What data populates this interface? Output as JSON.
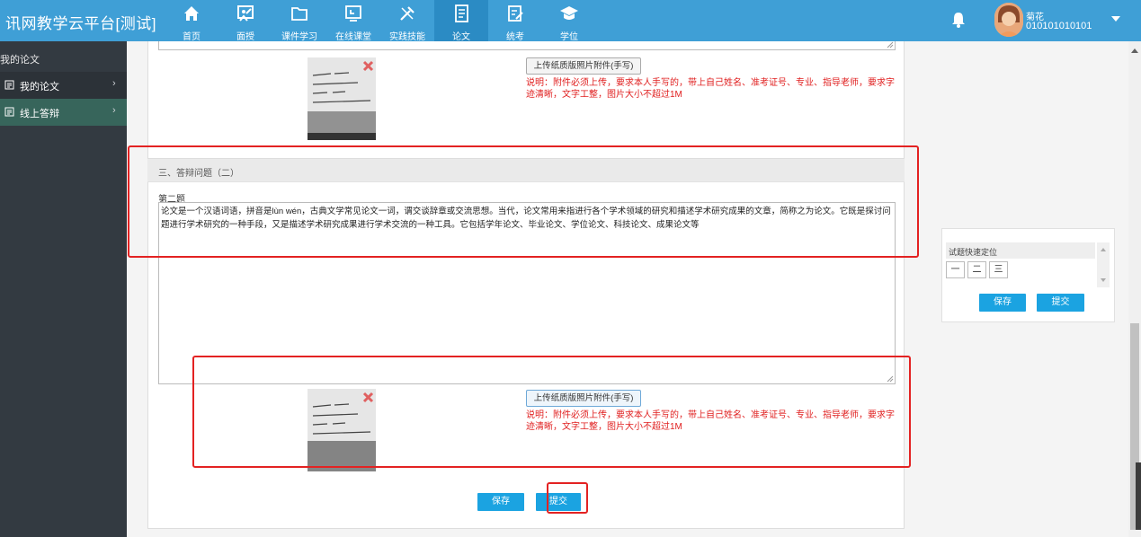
{
  "app": {
    "title": "讯网教学云平台[测试]"
  },
  "nav": {
    "items": [
      {
        "label": "首页",
        "icon": "home-icon"
      },
      {
        "label": "面授",
        "icon": "classroom-icon"
      },
      {
        "label": "课件学习",
        "icon": "folder-icon"
      },
      {
        "label": "在线课堂",
        "icon": "online-class-icon"
      },
      {
        "label": "实践技能",
        "icon": "tools-icon"
      },
      {
        "label": "论文",
        "icon": "paper-icon",
        "active": true
      },
      {
        "label": "统考",
        "icon": "exam-icon"
      },
      {
        "label": "学位",
        "icon": "graduation-cap-icon"
      }
    ]
  },
  "user": {
    "name": "菊花",
    "id": "010101010101"
  },
  "sidebar": {
    "title": "我的论文",
    "items": [
      {
        "label": "我的论文"
      },
      {
        "label": "线上答辩"
      }
    ]
  },
  "section": {
    "title": "三、答辩问题（二）",
    "question_label": "第二题",
    "answer": "论文是一个汉语词语，拼音是lùn wén，古典文学常见论文一词，谓交谈辞章或交流思想。当代，论文常用来指进行各个学术领域的研究和描述学术研究成果的文章，简称之为论文。它既是探讨问题进行学术研究的一种手段，又是描述学术研究成果进行学术交流的一种工具。它包括学年论文、毕业论文、学位论文、科技论文、成果论文等"
  },
  "upload": {
    "button_label": "上传纸质版照片附件(手写)",
    "note": "说明：附件必须上传，要求本人手写的，带上自己姓名、准考证号、专业、指导老师，要求字迹清晰，文字工整，图片大小不超过1M"
  },
  "actions": {
    "save": "保存",
    "submit": "提交"
  },
  "quick_nav": {
    "title": "试题快速定位",
    "boxes": [
      "一",
      "二",
      "三"
    ],
    "save": "保存",
    "submit": "提交"
  },
  "colors": {
    "topbar": "#3f9fd6",
    "sidebar": "#333a41",
    "accent": "#1ba3e1",
    "highlight": "#e32222"
  }
}
